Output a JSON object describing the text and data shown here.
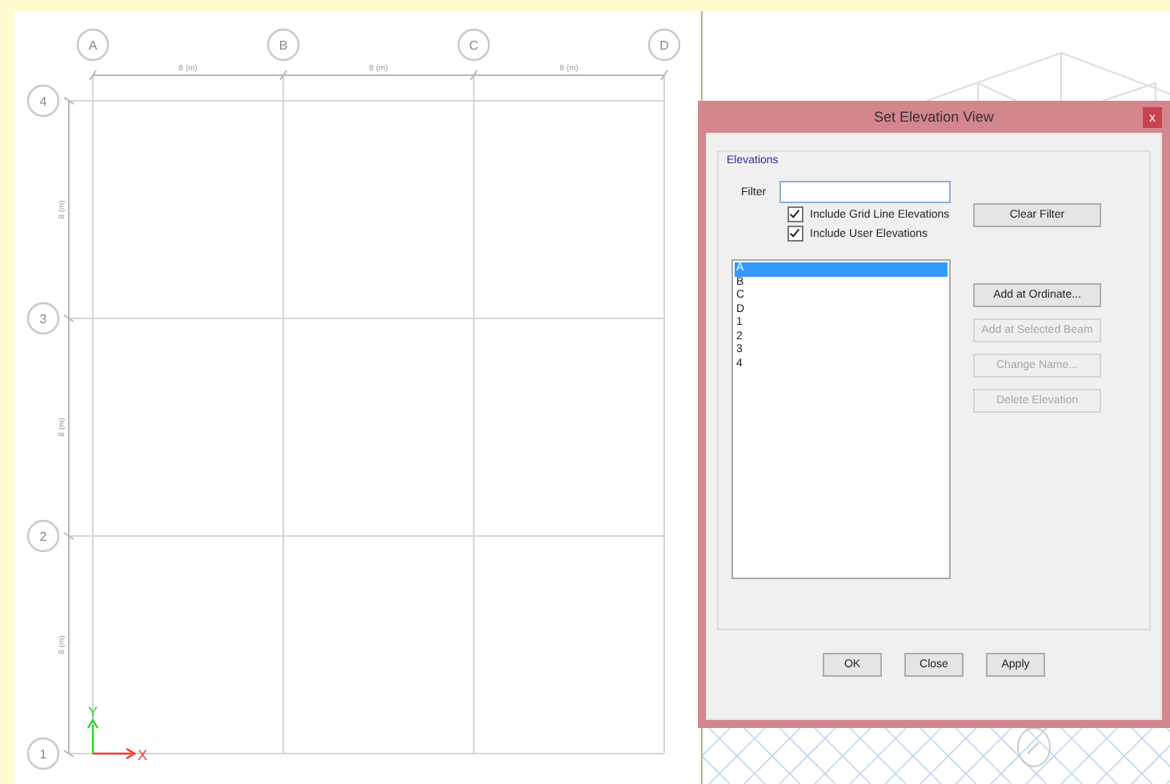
{
  "plan": {
    "column_bubbles": [
      "A",
      "B",
      "C",
      "D"
    ],
    "row_bubbles": [
      "4",
      "3",
      "2",
      "1"
    ],
    "x_dimensions": [
      "8 (m)",
      "8 (m)",
      "8 (m)"
    ],
    "y_dimensions": [
      "8 (m)",
      "8 (m)",
      "8 (m)"
    ],
    "axes": {
      "x": "X",
      "y": "Y"
    }
  },
  "dialog": {
    "title": "Set Elevation View",
    "close": "x",
    "group": "Elevations",
    "filter": {
      "label": "Filter"
    },
    "checkboxes": [
      {
        "label": "Include Grid Line Elevations",
        "checked": true
      },
      {
        "label": "Include User Elevations",
        "checked": true
      }
    ],
    "clear_button": {
      "label": "Clear Filter",
      "disabled": false
    },
    "elevations": [
      {
        "label": "A",
        "selected": true
      },
      {
        "label": "B",
        "selected": false
      },
      {
        "label": "C",
        "selected": false
      },
      {
        "label": "D",
        "selected": false
      },
      {
        "label": "1",
        "selected": false
      },
      {
        "label": "2",
        "selected": false
      },
      {
        "label": "3",
        "selected": false
      },
      {
        "label": "4",
        "selected": false
      }
    ],
    "side_buttons": [
      {
        "label": "Add at Ordinate...",
        "disabled": false
      },
      {
        "label": "Add at Selected Beam",
        "disabled": true
      },
      {
        "label": "Change Name...",
        "disabled": true
      },
      {
        "label": "Delete Elevation",
        "disabled": true
      }
    ],
    "buttons": [
      {
        "label": "OK"
      },
      {
        "label": "Close"
      },
      {
        "label": "Apply"
      }
    ]
  }
}
